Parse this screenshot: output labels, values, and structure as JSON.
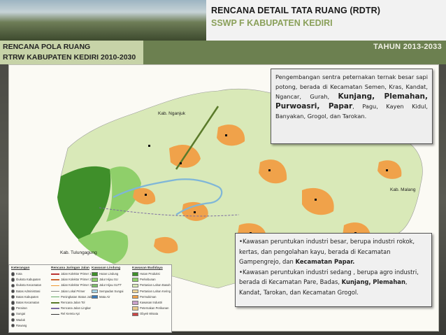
{
  "header": {
    "title": "RENCANA DETAIL TATA RUANG (RDTR)",
    "subtitle": "SSWP F KABUPATEN KEDIRI",
    "left_line1": "RENCANA POLA RUANG",
    "left_line2": "RTRW KABUPATEN KEDIRI 2010-2030",
    "year": "TAHUN 2013-2033"
  },
  "map": {
    "labels": {
      "nganjuk": "Kab. Nganjuk",
      "malang": "Kab. Malang",
      "tulungagung": "Kab. Tulungagung"
    }
  },
  "callout_top": {
    "p1": "Pengembangan sentra peternakan ternak besar sapi potong, berada di Kecamatan Semen, Kras, Kandat, Ngancar, Gurah,",
    "bold1": "Kunjang, Plemahan, Purwoasri, Papar",
    "p2": ", Pagu, Kayen Kidul, Banyakan, Grogol, dan Tarokan."
  },
  "callout_bottom": {
    "b1_pre": "•Kawasan peruntukan industri besar, berupa industri rokok, kertas, dan pengolahan kayu, berada di Kecamatan Gampengrejo, dan ",
    "b1_bold": "Kecamatan Papar.",
    "b2_pre": "•Kawasan peruntukan industri sedang , berupa agro industri, berada di Kecamatan Pare, Badas, ",
    "b2_bold1": "Kunjang,",
    "b2_bold2": "Plemahan",
    "b2_post": ", Kandat, Tarokan, dan Kecamatan Grogol."
  },
  "legend": {
    "title": "Keterangan",
    "col1_items": [
      "Kota",
      "Ibukota Kabupaten",
      "Ibukota Kecamatan",
      "Batas Administrasi",
      "Batas Kabupaten",
      "Batas Kecamatan",
      "Perairan",
      "Sungai",
      "Waduk",
      "Rawang"
    ],
    "col2_title": "Rencana Jaringan Jalan",
    "col2_items": [
      "Jalan Kolektor Primer 1",
      "Jalan Kolektor Primer 2",
      "Jalan Kolektor Primer 3",
      "Jalan Lokal Primer",
      "Peningkatan Status Jalan",
      "Rencana Jalan Tol",
      "Rencana Jalan Lingkar",
      "Rel Kereta Api"
    ],
    "col3_title": "Kawasan Lindung",
    "col3_items": [
      "Hutan Lindung",
      "Jalur Hijau SU",
      "Jalur Hijau SUTT",
      "Sempadan Sungai",
      "Mata Air"
    ],
    "col4_title": "Kawasan Budidaya",
    "col4_items": [
      "Hutan Produksi",
      "Perkebunan",
      "Pertanian Lahan Basah",
      "Pertanian Lahan Kering",
      "Permukiman",
      "Kawasan Industri",
      "Peternakan Perikanan",
      "Obyek Wisata"
    ],
    "colors": {
      "forest": "#3f8f2a",
      "plantation": "#8fcf6a",
      "wetland": "#d9e9b8",
      "dryland": "#f2d79a",
      "settlement": "#f0a24a",
      "industry": "#c9a0c9",
      "road": "#5a7a2a"
    }
  }
}
